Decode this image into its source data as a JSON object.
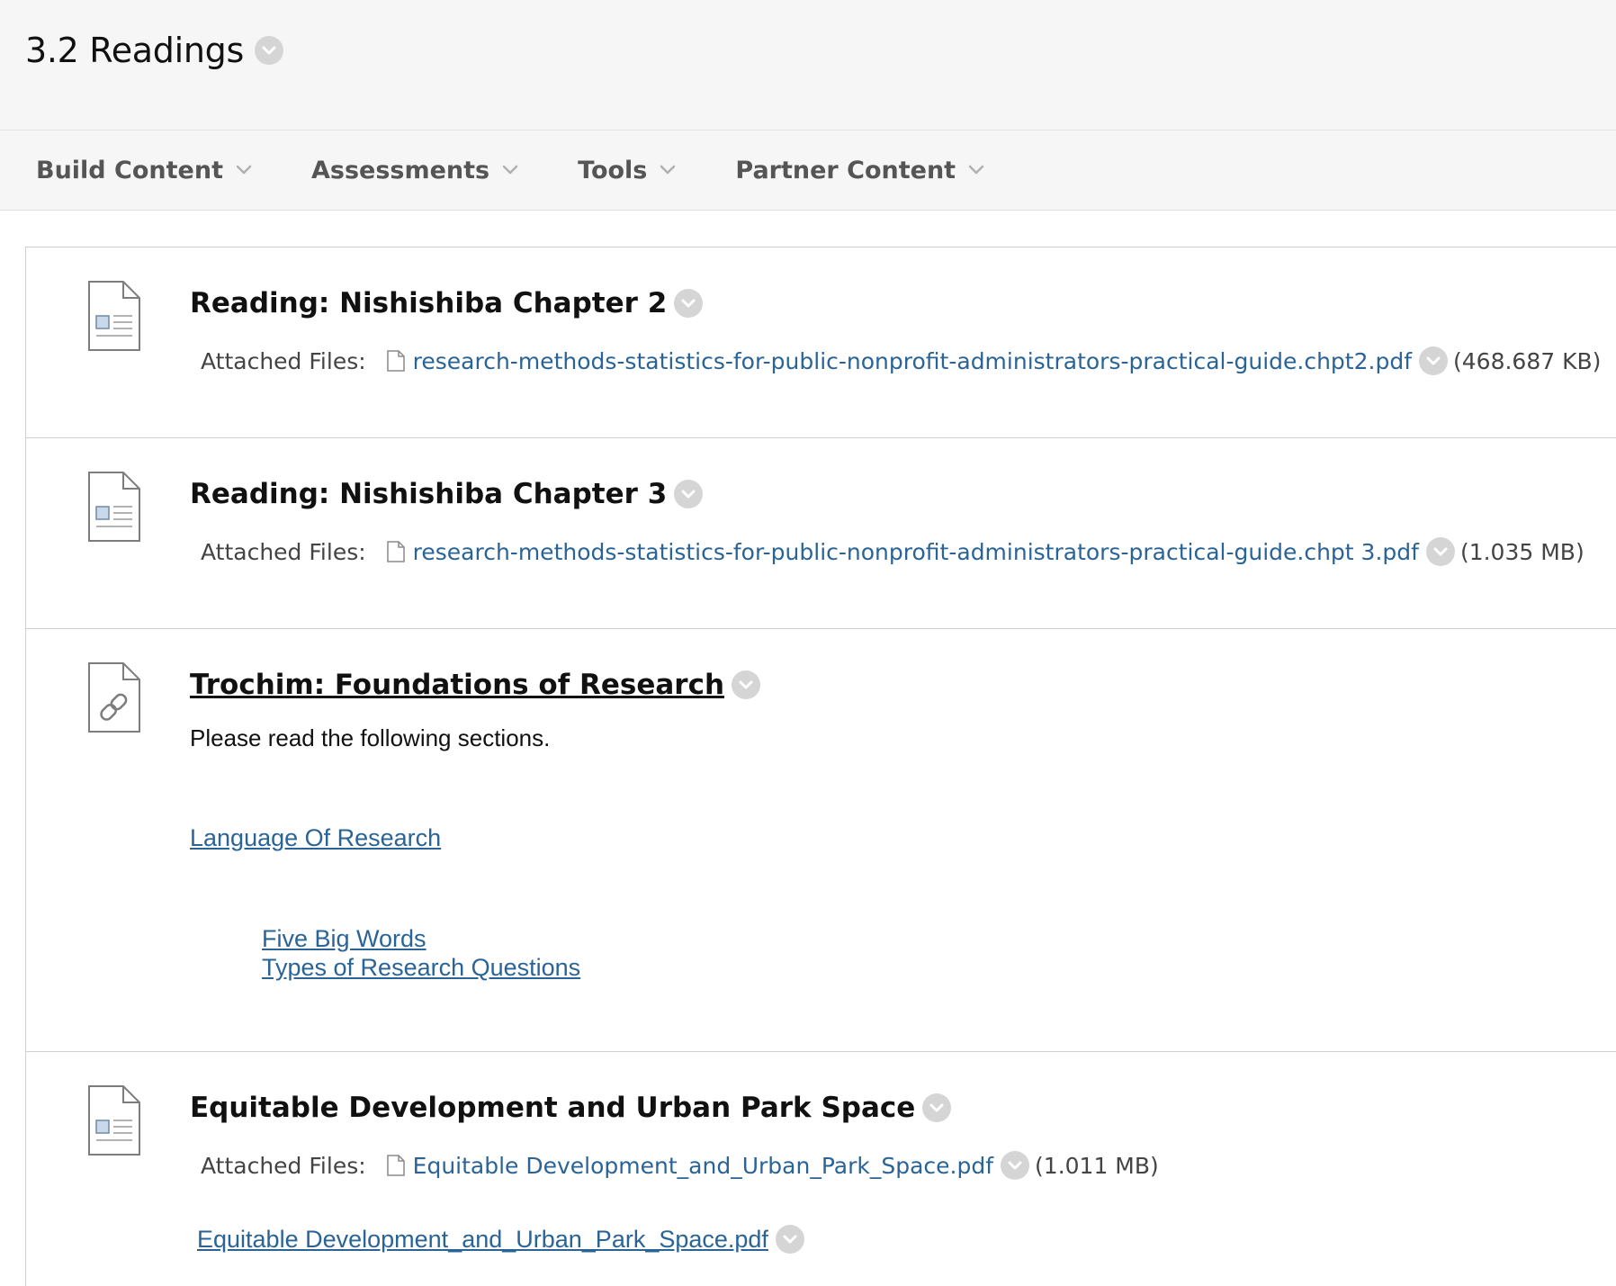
{
  "page": {
    "title": "3.2 Readings"
  },
  "toolbar": {
    "menus": [
      {
        "label": "Build Content"
      },
      {
        "label": "Assessments"
      },
      {
        "label": "Tools"
      },
      {
        "label": "Partner Content"
      }
    ]
  },
  "items": [
    {
      "title": "Reading: Nishishiba Chapter 2",
      "attached_label": "Attached Files:",
      "file_name": "research-methods-statistics-for-public-nonprofit-administrators-practical-guide.chpt2.pdf",
      "file_size": "(468.687 KB)",
      "icon": "document-icon"
    },
    {
      "title": "Reading: Nishishiba Chapter 3",
      "attached_label": "Attached Files:",
      "file_name": "research-methods-statistics-for-public-nonprofit-administrators-practical-guide.chpt 3.pdf",
      "file_size": "(1.035 MB)",
      "icon": "document-icon"
    },
    {
      "title": "Trochim: Foundations of Research",
      "description": "Please read the following sections.",
      "main_link": "Language Of Research",
      "sub_links": [
        "Five Big Words",
        "Types of Research Questions"
      ],
      "icon": "web-link-icon"
    },
    {
      "title": "Equitable Development and Urban Park Space",
      "attached_label": "Attached Files:",
      "file_name": "Equitable Development_and_Urban_Park_Space.pdf",
      "file_size": "(1.011 MB)",
      "inline_file_link": "Equitable Development_and_Urban_Park_Space.pdf",
      "icon": "document-icon"
    }
  ],
  "colors": {
    "link": "#2a6496",
    "header_bg": "#f6f6f6",
    "chevron_circle": "#d5d5d5"
  }
}
